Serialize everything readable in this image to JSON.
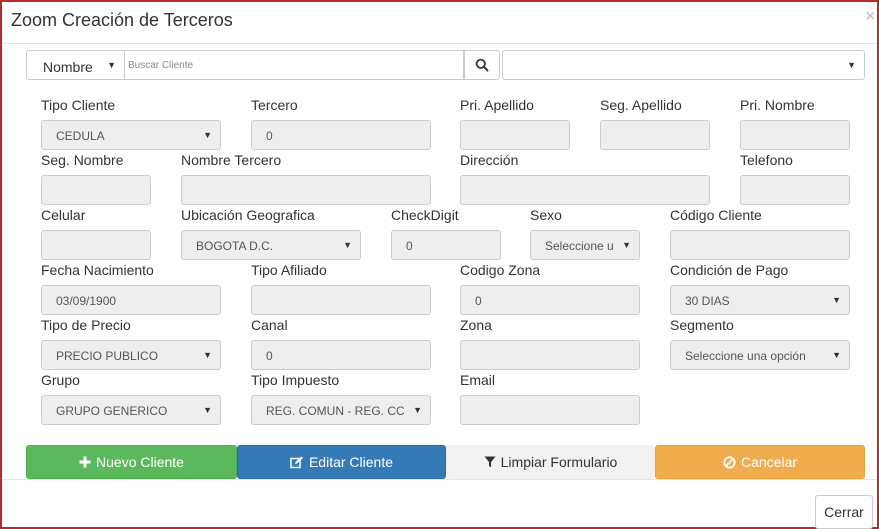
{
  "window": {
    "title": "Zoom Creación de Terceros",
    "close_glyph": "×"
  },
  "search": {
    "field_select": "Nombre",
    "input_placeholder": "Buscar Cliente",
    "right_select": ""
  },
  "form": {
    "tipo_cliente": {
      "label": "Tipo Cliente",
      "value": "CEDULA"
    },
    "tercero": {
      "label": "Tercero",
      "value": "0"
    },
    "pri_apellido": {
      "label": "Pri. Apellido",
      "value": ""
    },
    "seg_apellido": {
      "label": "Seg. Apellido",
      "value": ""
    },
    "pri_nombre": {
      "label": "Pri. Nombre",
      "value": ""
    },
    "seg_nombre": {
      "label": "Seg. Nombre",
      "value": ""
    },
    "nombre_tercero": {
      "label": "Nombre Tercero",
      "value": ""
    },
    "direccion": {
      "label": "Dirección",
      "value": ""
    },
    "telefono": {
      "label": "Telefono",
      "value": ""
    },
    "celular": {
      "label": "Celular",
      "value": ""
    },
    "ubicacion": {
      "label": "Ubicación Geografica",
      "value": "BOGOTA D.C."
    },
    "checkdigit": {
      "label": "CheckDigit",
      "value": "0"
    },
    "sexo": {
      "label": "Sexo",
      "value": "Seleccione u"
    },
    "codigo_cliente": {
      "label": "Código Cliente",
      "value": ""
    },
    "fecha_nacimiento": {
      "label": "Fecha Nacimiento",
      "value": "03/09/1900"
    },
    "tipo_afiliado": {
      "label": "Tipo Afiliado",
      "value": ""
    },
    "codigo_zona": {
      "label": "Codigo Zona",
      "value": "0"
    },
    "condicion_pago": {
      "label": "Condición de Pago",
      "value": "30 DIAS"
    },
    "tipo_precio": {
      "label": "Tipo de Precio",
      "value": "PRECIO PUBLICO"
    },
    "canal": {
      "label": "Canal",
      "value": "0"
    },
    "zona": {
      "label": "Zona",
      "value": ""
    },
    "segmento": {
      "label": "Segmento",
      "value": "Seleccione una opción"
    },
    "grupo": {
      "label": "Grupo",
      "value": "GRUPO GENERICO"
    },
    "tipo_impuesto": {
      "label": "Tipo Impuesto",
      "value": "REG. COMUN - REG. CC"
    },
    "email": {
      "label": "Email",
      "value": ""
    }
  },
  "actions": {
    "nuevo": "Nuevo Cliente",
    "editar": "Editar Cliente",
    "limpiar": "Limpiar Formulario",
    "cancelar": "Cancelar"
  },
  "footer": {
    "cerrar": "Cerrar"
  },
  "colors": {
    "frame_border": "#b52a2a",
    "success": "#5cb85c",
    "primary": "#337ab7",
    "warning": "#f0ad4e"
  },
  "icons": [
    "search-icon",
    "caret-down-icon",
    "plus-icon",
    "edit-icon",
    "filter-icon",
    "ban-icon",
    "close-icon"
  ]
}
